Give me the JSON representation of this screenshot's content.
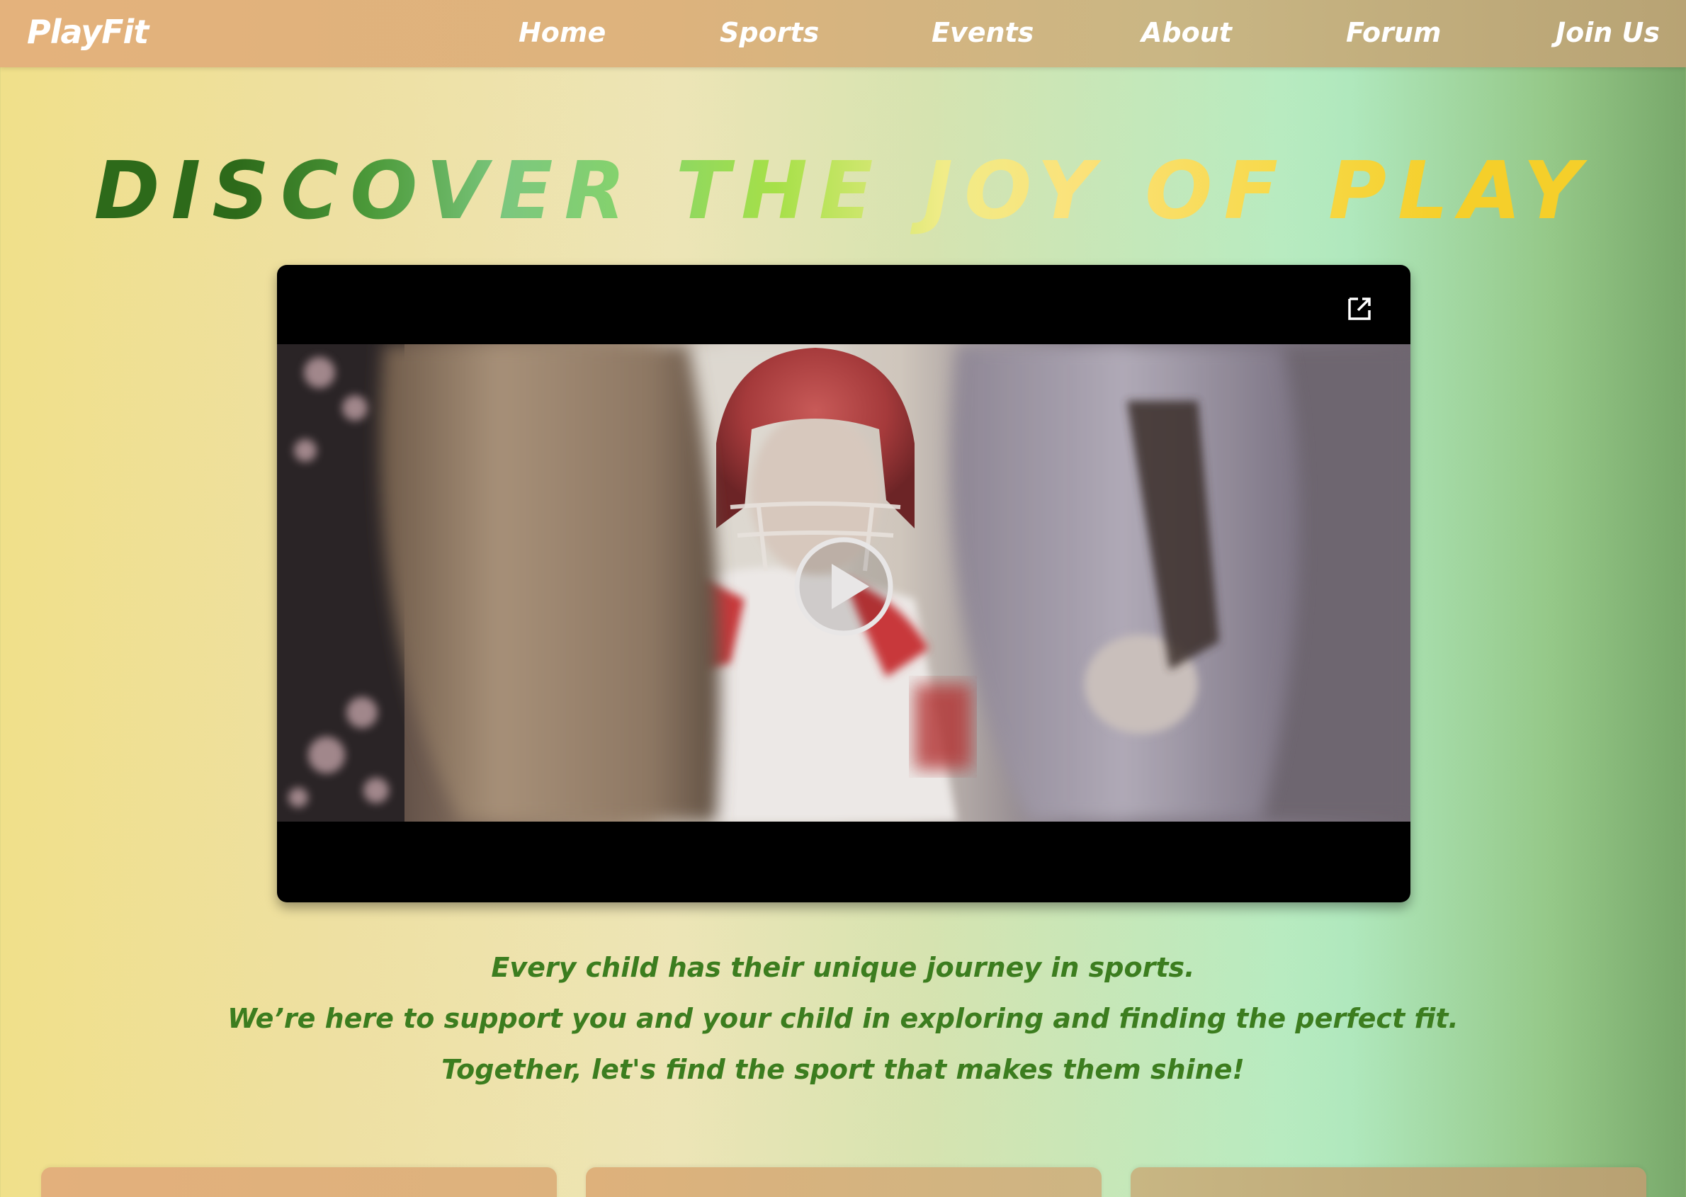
{
  "nav": {
    "logo": "PlayFit",
    "links": [
      {
        "label": "Home"
      },
      {
        "label": "Sports"
      },
      {
        "label": "Events"
      },
      {
        "label": "About"
      },
      {
        "label": "Forum"
      },
      {
        "label": "Join Us"
      }
    ]
  },
  "hero": {
    "title": "DISCOVER THE JOY OF PLAY"
  },
  "video": {
    "expand_icon": "external-link-icon",
    "play_icon": "play-icon"
  },
  "tagline": {
    "lines": [
      "Every child has their unique journey in sports.",
      "We’re here to support you and your child in exploring and finding the perfect fit.",
      "Together, let's find the sport that makes them shine!"
    ]
  },
  "colors": {
    "nav_bg": "#dfb27c",
    "tagline_text": "#3c7d1f",
    "title_green": "#2d6a1a",
    "title_yellow": "#f5cf2a"
  }
}
